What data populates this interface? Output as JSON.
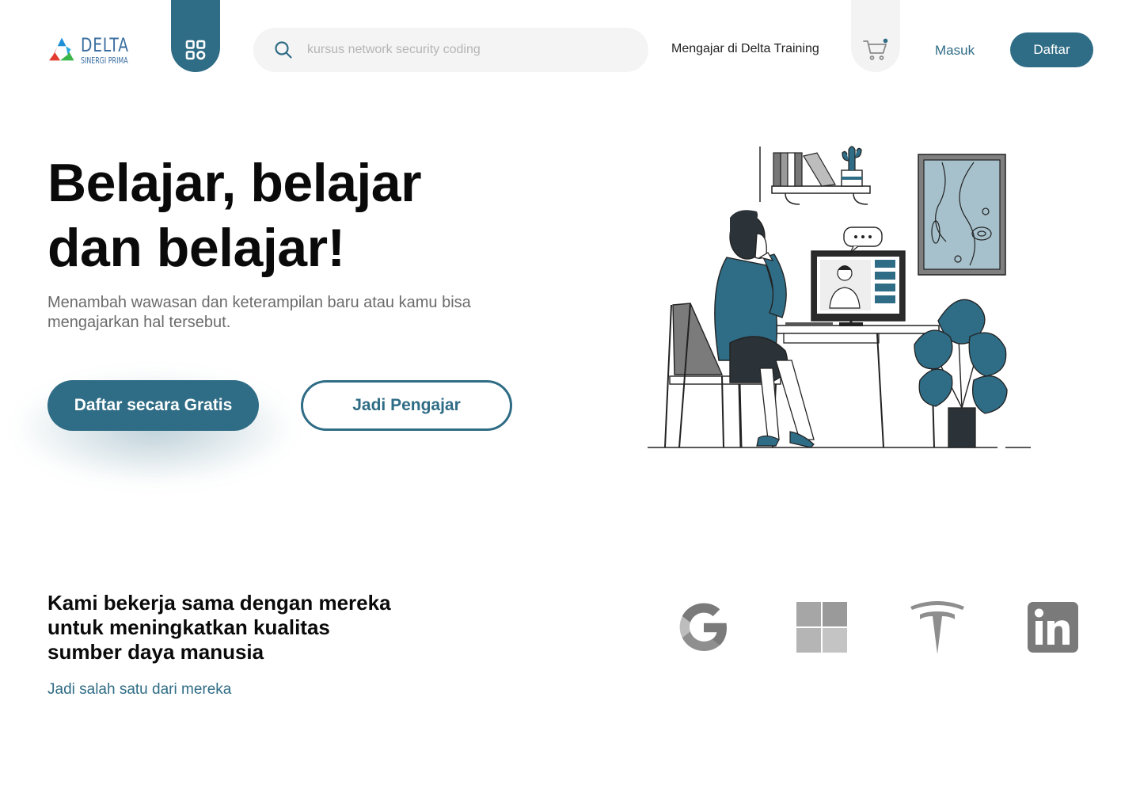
{
  "header": {
    "logo": {
      "word": "DELTA",
      "sub": "SINERGI PRIMA"
    },
    "menu_icon": "grid-icon",
    "search": {
      "placeholder": "kursus network security coding",
      "value": "",
      "icon": "search-icon"
    },
    "teach_link": "Mengajar di Delta Training",
    "cart_icon": "cart-icon",
    "login_label": "Masuk",
    "register_label": "Daftar"
  },
  "hero": {
    "title_line1": "Belajar, belajar",
    "title_line2": "dan belajar!",
    "subtitle": "Menambah wawasan dan keterampilan baru atau kamu bisa mengajarkan hal tersebut.",
    "primary_button": "Daftar secara Gratis",
    "secondary_button": "Jadi Pengajar"
  },
  "partners": {
    "heading_line1": "Kami bekerja sama dengan mereka",
    "heading_line2": "untuk meningkatkan kualitas",
    "heading_line3": "sumber daya manusia",
    "link": "Jadi salah satu dari mereka",
    "logos": [
      "google-logo",
      "windows-logo",
      "tesla-logo",
      "linkedin-logo"
    ]
  },
  "colors": {
    "accent": "#2f6c85",
    "text_dark": "#0a0a0a",
    "text_muted": "#6b6b6b",
    "search_bg": "#f4f4f4",
    "logo_gray": "#a3a3a3"
  }
}
